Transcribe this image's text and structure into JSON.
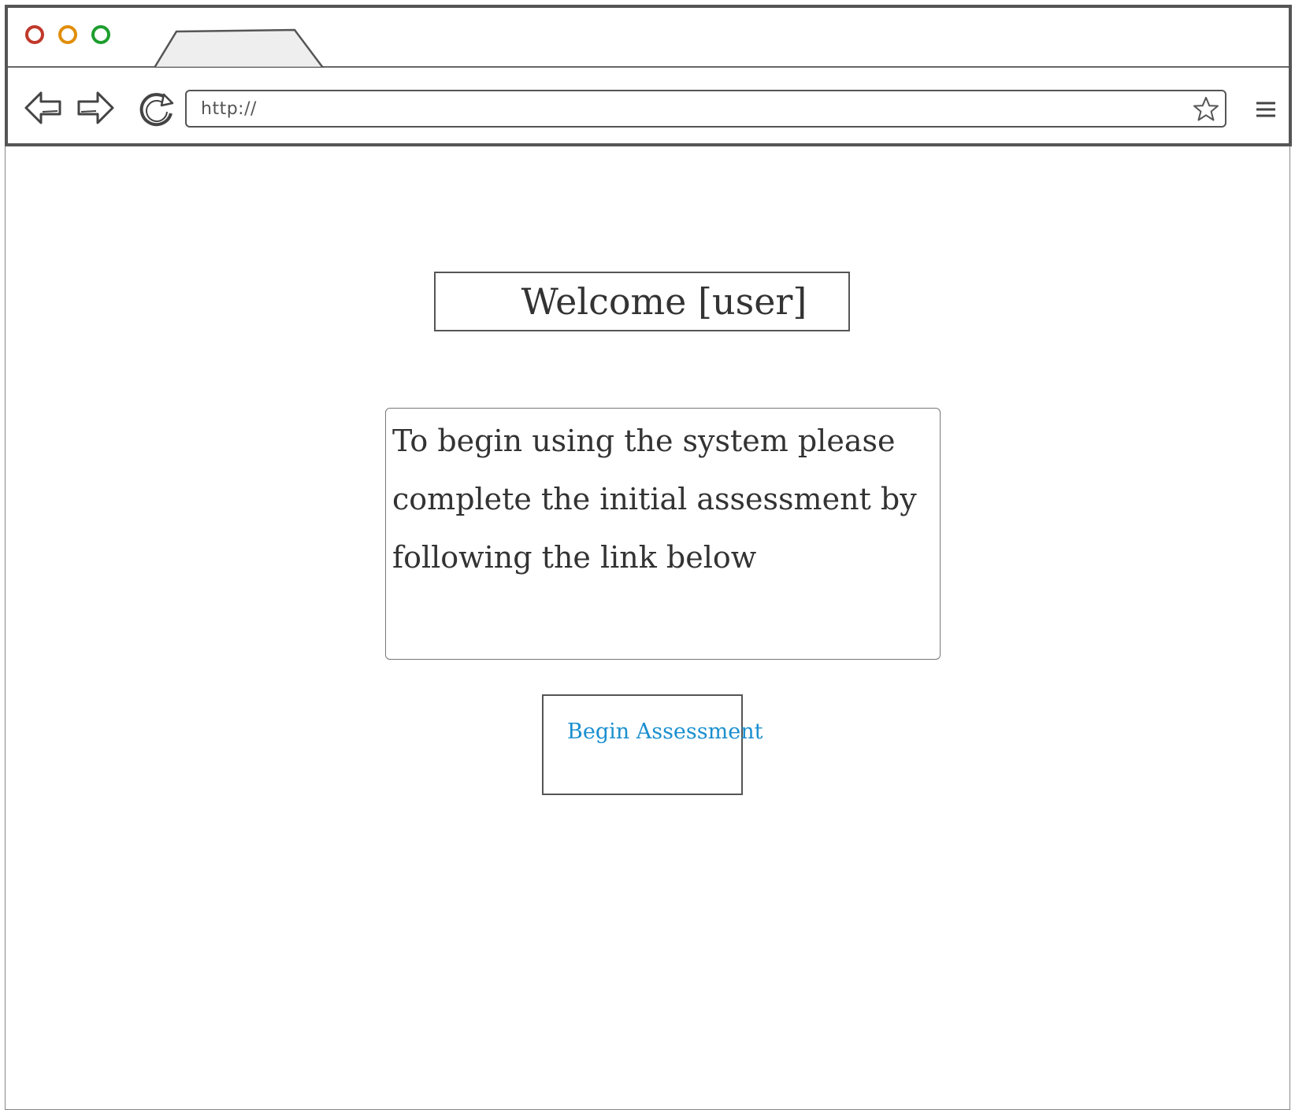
{
  "browser": {
    "window_controls": [
      {
        "name": "close",
        "color": "#c0392b"
      },
      {
        "name": "minimize",
        "color": "#e08e0b"
      },
      {
        "name": "maximize",
        "color": "#1e9e2e"
      }
    ],
    "address_bar": {
      "value": "http://"
    },
    "icons": {
      "back": "back-arrow-icon",
      "forward": "forward-arrow-icon",
      "reload": "reload-icon",
      "bookmark": "star-icon",
      "menu": "hamburger-menu-icon"
    }
  },
  "page": {
    "welcome_title": "Welcome [user]",
    "message": "To begin using the system please complete the initial assessment by following the link below",
    "button_label": "Begin Assessment",
    "colors": {
      "link": "#1a8fcf",
      "sketch_stroke": "#555555"
    }
  }
}
